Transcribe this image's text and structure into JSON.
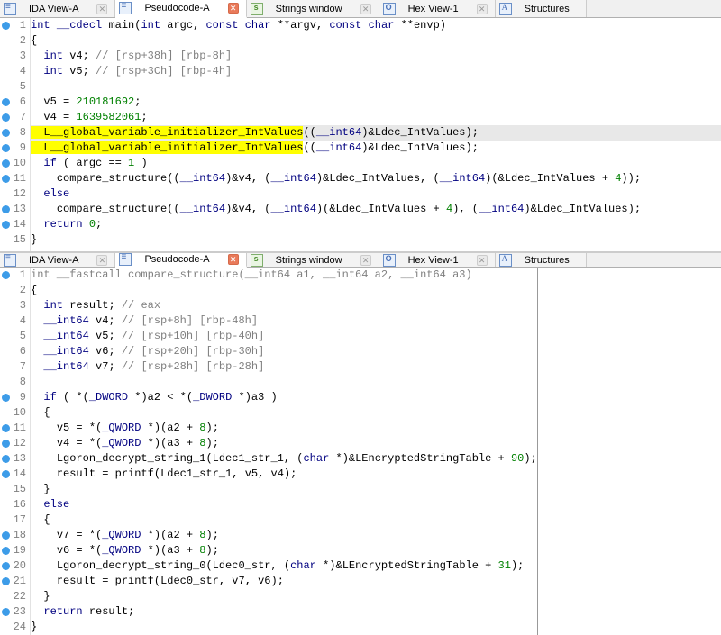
{
  "tabbar": {
    "tabs": [
      {
        "label": "IDA View-A"
      },
      {
        "label": "Pseudocode-A"
      },
      {
        "label": "Strings window"
      },
      {
        "label": "Hex View-1"
      },
      {
        "label": "Structures"
      }
    ]
  },
  "top": {
    "lines": [
      "int __cdecl main(int argc, const char **argv, const char **envp)",
      "{",
      "  int v4; // [rsp+38h] [rbp-8h]",
      "  int v5; // [rsp+3Ch] [rbp-4h]",
      "",
      "  v5 = 210181692;",
      "  v4 = 1639582061;",
      "  L__global_variable_initializer_IntValues((__int64)&Ldec_IntValues);",
      "  L__global_variable_initializer_IntValues((__int64)&Ldec_IntValues);",
      "  if ( argc == 1 )",
      "    compare_structure((__int64)&v4, (__int64)&Ldec_IntValues, (__int64)(&Ldec_IntValues + 4));",
      "  else",
      "    compare_structure((__int64)&v4, (__int64)(&Ldec_IntValues + 4), (__int64)&Ldec_IntValues);",
      "  return 0;",
      "}"
    ],
    "bp_lines": [
      1,
      6,
      7,
      8,
      9,
      10,
      11,
      13,
      14
    ]
  },
  "bottom": {
    "lines": [
      "int __fastcall compare_structure(__int64 a1, __int64 a2, __int64 a3)",
      "{",
      "  int result; // eax",
      "  __int64 v4; // [rsp+8h] [rbp-48h]",
      "  __int64 v5; // [rsp+10h] [rbp-40h]",
      "  __int64 v6; // [rsp+20h] [rbp-30h]",
      "  __int64 v7; // [rsp+28h] [rbp-28h]",
      "",
      "  if ( *(_DWORD *)a2 < *(_DWORD *)a3 )",
      "  {",
      "    v5 = *(_QWORD *)(a2 + 8);",
      "    v4 = *(_QWORD *)(a3 + 8);",
      "    Lgoron_decrypt_string_1(Ldec1_str_1, (char *)&LEncryptedStringTable + 90);",
      "    result = printf(Ldec1_str_1, v5, v4);",
      "  }",
      "  else",
      "  {",
      "    v7 = *(_QWORD *)(a2 + 8);",
      "    v6 = *(_QWORD *)(a3 + 8);",
      "    Lgoron_decrypt_string_0(Ldec0_str, (char *)&LEncryptedStringTable + 31);",
      "    result = printf(Ldec0_str, v7, v6);",
      "  }",
      "  return result;",
      "}"
    ],
    "bp_lines": [
      1,
      9,
      11,
      12,
      13,
      14,
      18,
      19,
      20,
      21,
      23
    ]
  }
}
